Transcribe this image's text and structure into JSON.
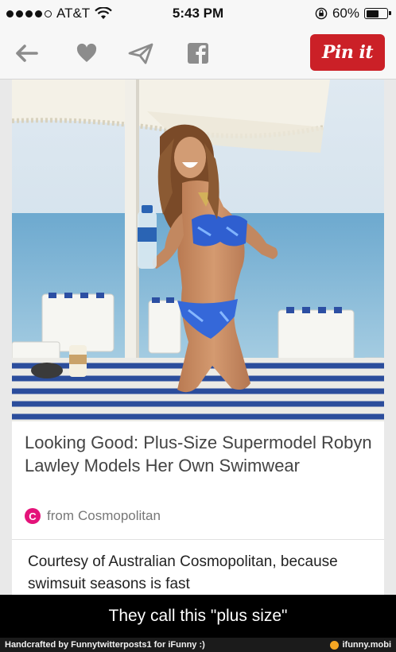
{
  "status_bar": {
    "carrier": "AT&T",
    "time": "5:43 PM",
    "battery_text": "60%",
    "battery_level": 0.6,
    "icons": [
      "signal-dots-icon",
      "wifi-icon",
      "rotation-lock-icon",
      "battery-icon"
    ]
  },
  "toolbar": {
    "icons": [
      "back-arrow-icon",
      "heart-icon",
      "send-icon",
      "facebook-icon"
    ],
    "pin_label": "Pin it",
    "pin_color": "#cb2027"
  },
  "pin": {
    "title": "Looking Good: Plus-Size Supermodel Robyn Lawley Models Her Own Swimwear",
    "source_prefix": "from",
    "source_name": "Cosmopolitan",
    "source_badge": "C",
    "source_color": "#e4137a",
    "description": "Courtesy of Australian Cosmopolitan, because swimsuit seasons is fast"
  },
  "meme": {
    "caption": "They call this \"plus size\"",
    "credit": "Handcrafted by Funnytwitterposts1 for iFunny :)",
    "brand": "ifunny.mobi"
  }
}
